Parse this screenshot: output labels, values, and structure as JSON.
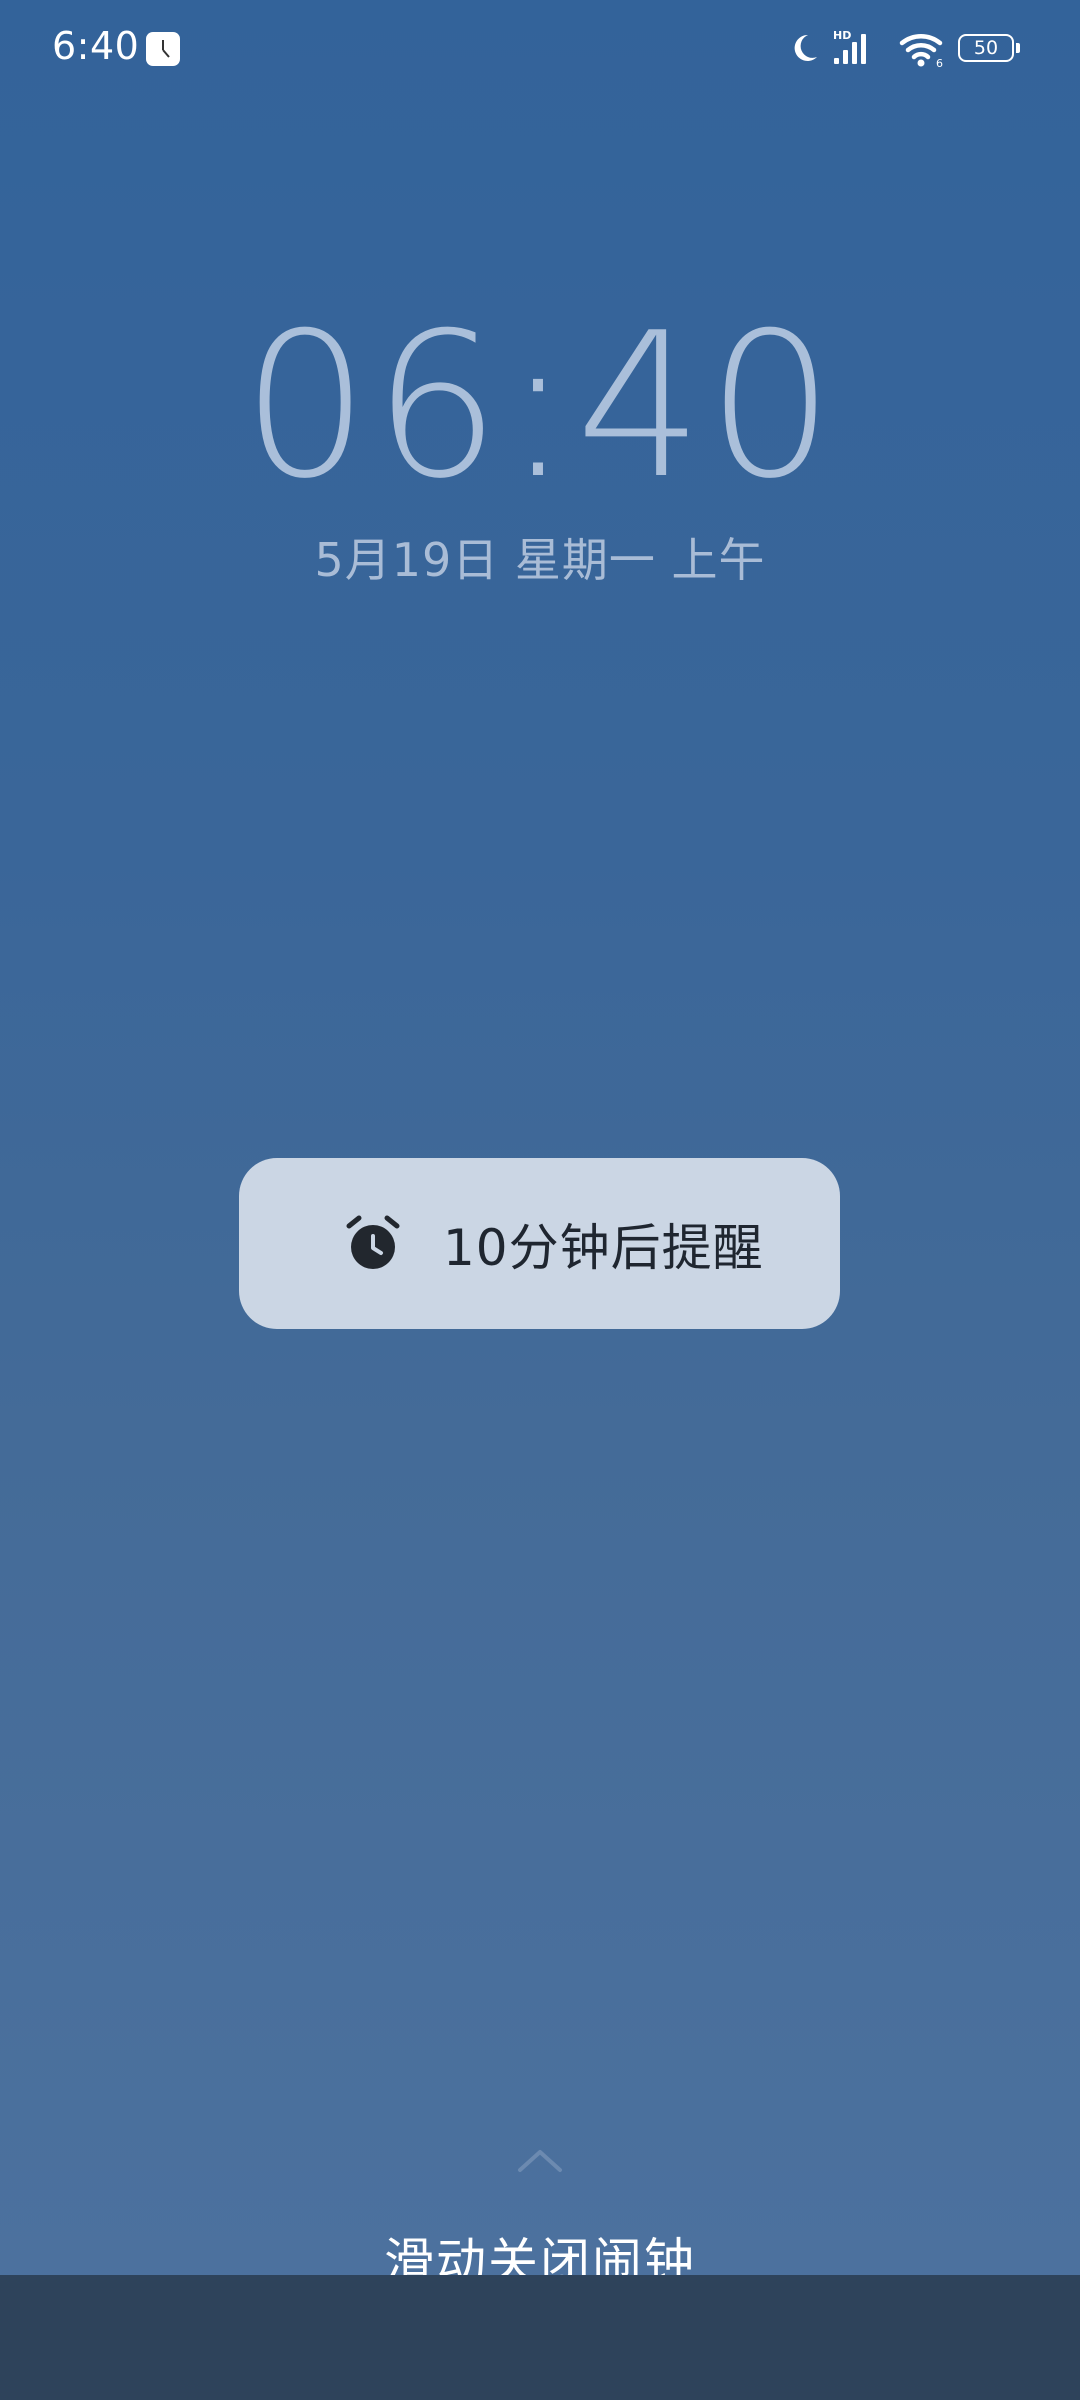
{
  "status_bar": {
    "time": "6:40",
    "battery_level": "50",
    "icons": [
      "clock-app-icon",
      "moon-icon",
      "hd-signal-icon",
      "wifi-icon",
      "battery-icon"
    ]
  },
  "lockscreen": {
    "clock": "06:40",
    "date": "5月19日 星期一 上午"
  },
  "alarm": {
    "snooze_label": "10分钟后提醒",
    "snooze_icon": "alarm-clock-icon",
    "swipe_hint": "滑动关闭闹钟",
    "swipe_icon": "chevron-up-icon"
  },
  "colors": {
    "background_top": "#33639a",
    "background_bottom": "#4d729f",
    "snooze_pill": "#cbd6e4",
    "nav_bar": "#2e435b"
  }
}
